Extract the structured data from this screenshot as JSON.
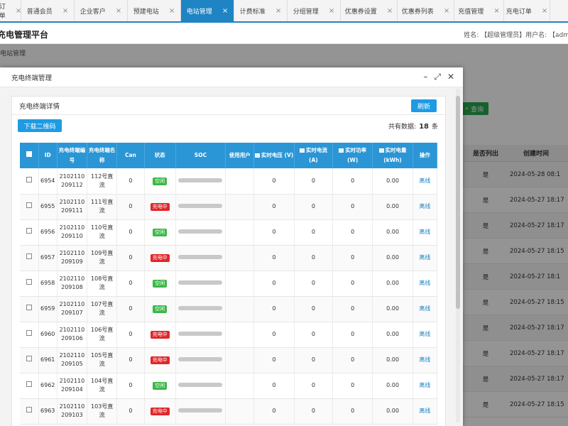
{
  "tabs": [
    {
      "label": "订单",
      "active": false
    },
    {
      "label": "普通会员",
      "active": false
    },
    {
      "label": "企业客户",
      "active": false
    },
    {
      "label": "预建电站",
      "active": false
    },
    {
      "label": "电站管理",
      "active": true
    },
    {
      "label": "计费标准",
      "active": false
    },
    {
      "label": "分组管理",
      "active": false
    },
    {
      "label": "优惠券设置",
      "active": false
    },
    {
      "label": "优惠券列表",
      "active": false
    },
    {
      "label": "充值管理",
      "active": false
    },
    {
      "label": "充电订单",
      "active": false
    }
  ],
  "header": {
    "title": "充电管理平台",
    "user_info": "姓名: 【超级管理员】用户名: 【adm"
  },
  "background": {
    "breadcrumb": "电站管理",
    "search_label": "查询",
    "columns": [
      "",
      "是否列出",
      "创建时间"
    ],
    "rows": [
      {
        "listed": "是",
        "created": "2024-05-28 08:1"
      },
      {
        "listed": "是",
        "created": "2024-05-27 18:17"
      },
      {
        "listed": "是",
        "created": "2024-05-27 18:17"
      },
      {
        "listed": "是",
        "created": "2024-05-27 18:15"
      },
      {
        "listed": "是",
        "created": "2024-05-27 18:1"
      },
      {
        "listed": "是",
        "created": "2024-05-27 18:15"
      },
      {
        "listed": "是",
        "created": "2024-05-27 18:17"
      },
      {
        "listed": "是",
        "created": "2024-05-27 18:17"
      },
      {
        "listed": "是",
        "created": "2024-05-27 18:17"
      },
      {
        "listed": "是",
        "created": "2024-05-27 18:15"
      }
    ]
  },
  "modal": {
    "title": "充电终端管理",
    "panel_title": "充电终端详情",
    "refresh_label": "刷新",
    "qr_label": "下载二维码",
    "total_prefix": "共有数据:",
    "total_count": "18",
    "total_suffix": "条",
    "columns": {
      "id": "ID",
      "terminal_no": "充电终端编号",
      "terminal_name": "充电终端名称",
      "can": "Can",
      "status": "状态",
      "soc": "SOC",
      "user": "使用用户",
      "voltage": "实时电压 (V)",
      "current": "实时电流 (A)",
      "power": "实时功率 (W)",
      "energy": "实时电量 (kWh)",
      "op": "操作"
    },
    "rows": [
      {
        "id": "6954",
        "no1": "2102110",
        "no2": "209112",
        "name1": "112号直",
        "name2": "流",
        "can": "0",
        "status": "空闲",
        "charging": false,
        "voltage": "0",
        "current": "0",
        "power": "0",
        "energy": "0.00",
        "op": "离线"
      },
      {
        "id": "6955",
        "no1": "2102110",
        "no2": "209111",
        "name1": "111号直",
        "name2": "流",
        "can": "0",
        "status": "充电中",
        "charging": true,
        "voltage": "0",
        "current": "0",
        "power": "0",
        "energy": "0.00",
        "op": "离线"
      },
      {
        "id": "6956",
        "no1": "2102110",
        "no2": "209110",
        "name1": "110号直",
        "name2": "流",
        "can": "0",
        "status": "空闲",
        "charging": false,
        "voltage": "0",
        "current": "0",
        "power": "0",
        "energy": "0.00",
        "op": "离线"
      },
      {
        "id": "6957",
        "no1": "2102110",
        "no2": "209109",
        "name1": "109号直",
        "name2": "流",
        "can": "0",
        "status": "充电中",
        "charging": true,
        "voltage": "0",
        "current": "0",
        "power": "0",
        "energy": "0.00",
        "op": "离线"
      },
      {
        "id": "6958",
        "no1": "2102110",
        "no2": "209108",
        "name1": "108号直",
        "name2": "流",
        "can": "0",
        "status": "空闲",
        "charging": false,
        "voltage": "0",
        "current": "0",
        "power": "0",
        "energy": "0.00",
        "op": "离线"
      },
      {
        "id": "6959",
        "no1": "2102110",
        "no2": "209107",
        "name1": "107号直",
        "name2": "流",
        "can": "0",
        "status": "空闲",
        "charging": false,
        "voltage": "0",
        "current": "0",
        "power": "0",
        "energy": "0.00",
        "op": "离线"
      },
      {
        "id": "6960",
        "no1": "2102110",
        "no2": "209106",
        "name1": "106号直",
        "name2": "流",
        "can": "0",
        "status": "充电中",
        "charging": true,
        "voltage": "0",
        "current": "0",
        "power": "0",
        "energy": "0.00",
        "op": "离线"
      },
      {
        "id": "6961",
        "no1": "2102110",
        "no2": "209105",
        "name1": "105号直",
        "name2": "流",
        "can": "0",
        "status": "充电中",
        "charging": true,
        "voltage": "0",
        "current": "0",
        "power": "0",
        "energy": "0.00",
        "op": "离线"
      },
      {
        "id": "6962",
        "no1": "2102110",
        "no2": "209104",
        "name1": "104号直",
        "name2": "流",
        "can": "0",
        "status": "空闲",
        "charging": false,
        "voltage": "0",
        "current": "0",
        "power": "0",
        "energy": "0.00",
        "op": "离线"
      },
      {
        "id": "6963",
        "no1": "2102110",
        "no2": "209103",
        "name1": "103号直",
        "name2": "流",
        "can": "0",
        "status": "充电中",
        "charging": true,
        "voltage": "0",
        "current": "0",
        "power": "0",
        "energy": "0.00",
        "op": "离线"
      }
    ]
  },
  "colors": {
    "accent": "#1e84c4",
    "header_blue": "#2a96d6",
    "button_blue": "#1e9be3",
    "idle_green": "#3bb847",
    "charging_red": "#e0262a",
    "search_green": "#27a74f"
  }
}
